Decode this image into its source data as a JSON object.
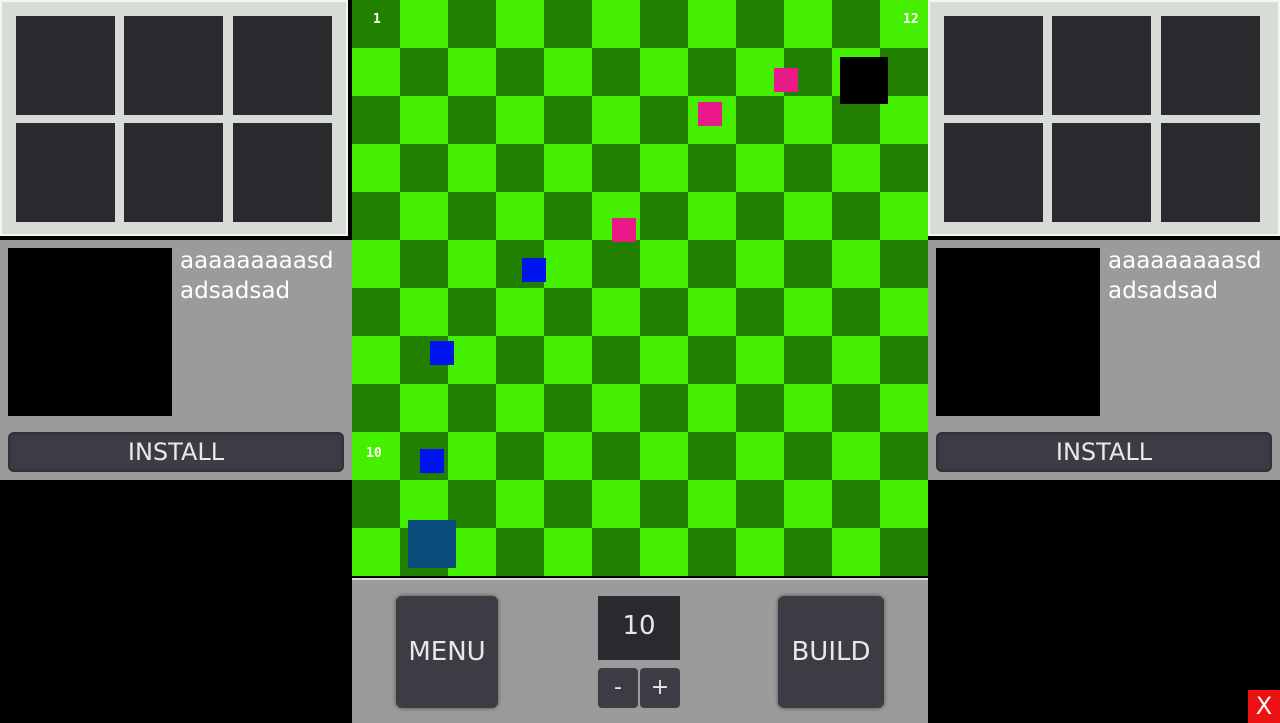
{
  "colors": {
    "light_tile": "#44f000",
    "dark_tile": "#228000",
    "enemy": "#e81a8a",
    "tower": "#0014f0",
    "base": "#0a4c7a",
    "target": "#000000"
  },
  "board": {
    "rows": 12,
    "cols": 12,
    "corner_top_left": "1",
    "corner_top_right": "12",
    "corner_left_row10": "10"
  },
  "units": [
    {
      "type": "target",
      "name": "target-tile"
    },
    {
      "type": "enemy",
      "name": "enemy-unit"
    },
    {
      "type": "enemy",
      "name": "enemy-unit"
    },
    {
      "type": "enemy",
      "name": "enemy-unit"
    },
    {
      "type": "tower",
      "name": "tower-unit"
    },
    {
      "type": "tower",
      "name": "tower-unit"
    },
    {
      "type": "tower",
      "name": "tower-unit"
    },
    {
      "type": "base",
      "name": "base-unit"
    }
  ],
  "left_panel": {
    "description": "aaaaaaaaasdadsadsad",
    "install_label": "INSTALL"
  },
  "right_panel": {
    "description": "aaaaaaaaasdadsadsad",
    "install_label": "INSTALL"
  },
  "controls": {
    "menu_label": "MENU",
    "build_label": "BUILD",
    "count_value": "10",
    "minus_label": "-",
    "plus_label": "+"
  },
  "close_label": "X"
}
